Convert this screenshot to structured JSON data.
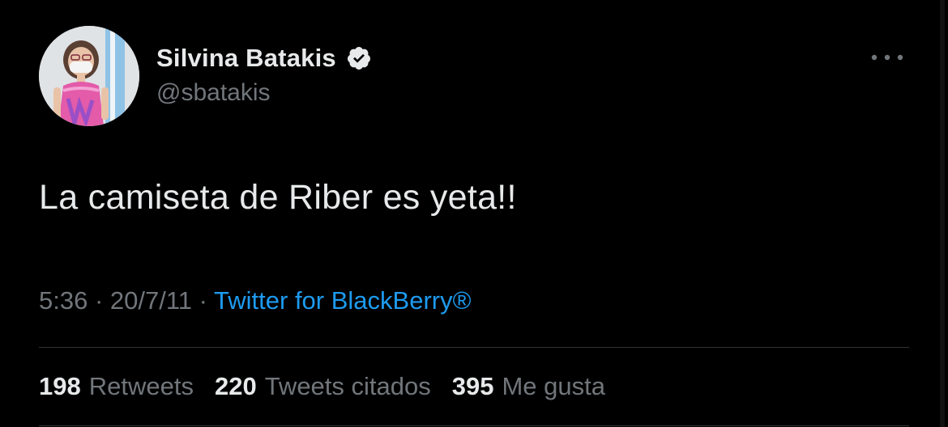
{
  "author": {
    "display_name": "Silvina Batakis",
    "handle": "@sbatakis",
    "verified": true
  },
  "tweet": {
    "text": "La camiseta de Riber es yeta!!",
    "time": "5:36",
    "separator1": " · ",
    "date": "20/7/11",
    "separator2": " · ",
    "source": "Twitter for BlackBerry®"
  },
  "stats": {
    "retweets_count": "198",
    "retweets_label": "Retweets",
    "quotes_count": "220",
    "quotes_label": "Tweets citados",
    "likes_count": "395",
    "likes_label": "Me gusta"
  },
  "colors": {
    "background": "#000000",
    "primary_text": "#e7e9ea",
    "secondary_text": "#71767b",
    "link": "#1d9bf0",
    "divider": "#2f3336"
  },
  "icons": {
    "verified": "verified-badge-icon",
    "more": "more-horizontal-icon"
  }
}
